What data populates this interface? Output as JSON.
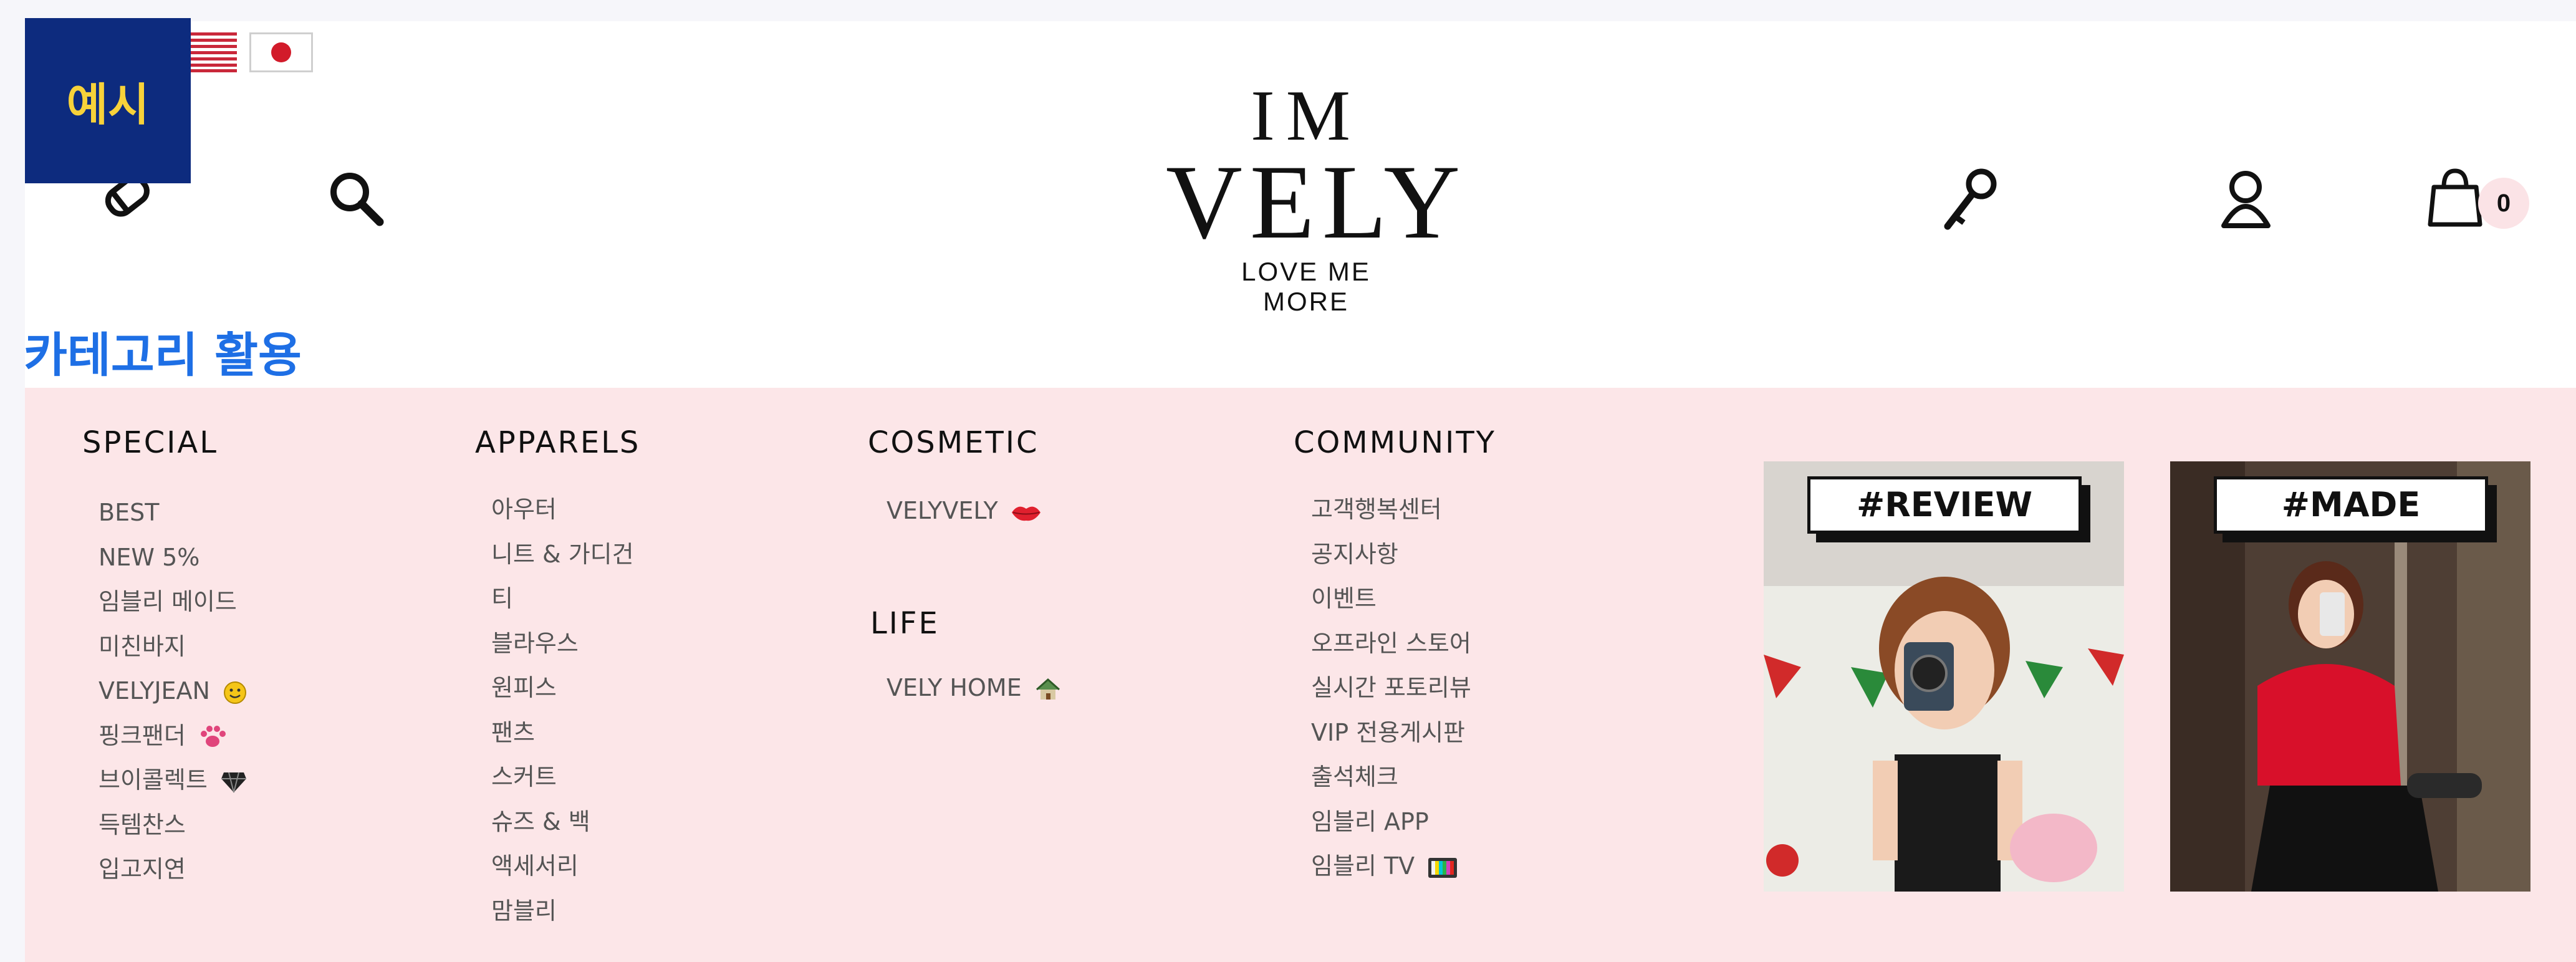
{
  "badge": {
    "label": "예시"
  },
  "header": {
    "logo": {
      "line1": "IM",
      "line2": "VELY",
      "tagline_1": "LOVE ME",
      "tagline_2": "MORE"
    },
    "icons": {
      "left": [
        "bookmark-tag-icon",
        "search-icon"
      ],
      "right": [
        "key-icon",
        "user-icon",
        "shopping-bag-icon"
      ]
    },
    "cart_count": "0",
    "languages": [
      "us-flag-icon",
      "japan-flag-icon"
    ]
  },
  "category_title": "카테고리 활용",
  "menu": {
    "special": {
      "heading": "SPECIAL",
      "items": [
        "BEST",
        "NEW 5%",
        "임블리 메이드",
        "미친바지",
        "VELYJEAN",
        "핑크팬더",
        "브이콜렉트",
        "득템찬스",
        "입고지연"
      ]
    },
    "apparels": {
      "heading": "APPARELS",
      "items": [
        "아우터",
        "니트 & 가디건",
        "티",
        "블라우스",
        "원피스",
        "팬츠",
        "스커트",
        "슈즈 & 백",
        "액세서리",
        "맘블리"
      ]
    },
    "cosmetic": {
      "heading": "COSMETIC",
      "items": [
        "VELYVELY"
      ]
    },
    "life": {
      "heading": "LIFE",
      "items": [
        "VELY HOME"
      ]
    },
    "community": {
      "heading": "COMMUNITY",
      "items": [
        "고객행복센터",
        "공지사항",
        "이벤트",
        "오프라인 스토어",
        "실시간 포토리뷰",
        "VIP 전용게시판",
        "출석체크",
        "임블리 APP",
        "임블리 TV"
      ]
    },
    "promos": [
      {
        "label": "#REVIEW"
      },
      {
        "label": "#MADE"
      }
    ]
  },
  "colors": {
    "badge_bg": "#0d2b7e",
    "badge_text": "#f7d23a",
    "category_title": "#1e6fe5",
    "menu_bg": "#fce6e8"
  }
}
